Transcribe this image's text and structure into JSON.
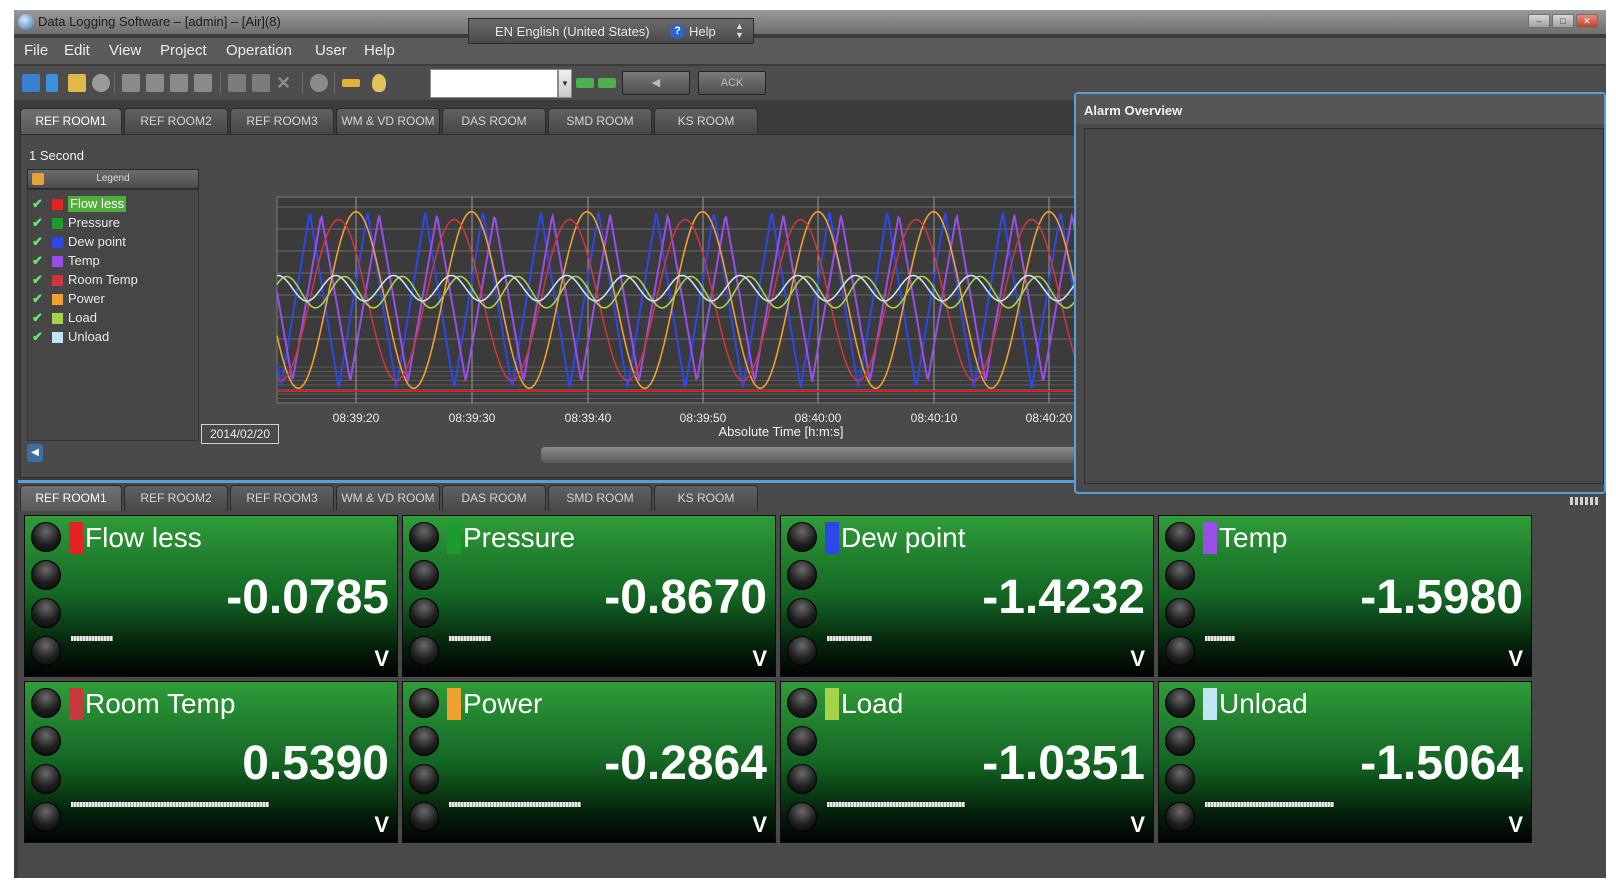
{
  "window": {
    "title": "Data Logging Software – [admin] – [Air](8)",
    "language": "EN English (United States)",
    "help_label": "Help"
  },
  "menu": [
    "File",
    "Edit",
    "View",
    "Project",
    "Operation",
    "User",
    "Help"
  ],
  "toolbar": {
    "combo_value": "",
    "btn_prev_label": "◀",
    "btn_ack_label": "ACK",
    "icons": [
      "grid-icon",
      "import-icon",
      "open-folder-icon",
      "refresh-icon",
      "folder-icon",
      "folder-icon",
      "folder-icon",
      "folder-icon",
      "copy-icon",
      "paste-icon",
      "delete-icon",
      "search-icon",
      "edit-icon",
      "lightbulb-icon",
      "mail-icon",
      "mail-icon"
    ]
  },
  "tabs": [
    "REF ROOM1",
    "REF ROOM2",
    "REF ROOM3",
    "WM & VD ROOM",
    "DAS ROOM",
    "SMD ROOM",
    "KS ROOM"
  ],
  "active_tab": "REF ROOM1",
  "chart_panel": {
    "interval": "1 Second",
    "legend_header": "Legend",
    "date": "2014/02/20",
    "legend": [
      {
        "label": "Flow less",
        "color": "#e52222",
        "checked": true,
        "selected": true
      },
      {
        "label": "Pressure",
        "color": "#1e9a2e",
        "checked": true,
        "selected": false
      },
      {
        "label": "Dew point",
        "color": "#2c48e8",
        "checked": true,
        "selected": false
      },
      {
        "label": "Temp",
        "color": "#9a4ee8",
        "checked": true,
        "selected": false
      },
      {
        "label": "Room Temp",
        "color": "#c8383c",
        "checked": true,
        "selected": false
      },
      {
        "label": "Power",
        "color": "#f0a030",
        "checked": true,
        "selected": false
      },
      {
        "label": "Load",
        "color": "#a6d24a",
        "checked": true,
        "selected": false
      },
      {
        "label": "Unload",
        "color": "#bfe6f2",
        "checked": true,
        "selected": false
      }
    ]
  },
  "chart_data": {
    "type": "line",
    "xlabel": "Absolute Time [h:m:s]",
    "x_ticks": [
      "08:39:20",
      "08:39:30",
      "08:39:40",
      "08:39:50",
      "08:40:00",
      "08:40:10",
      "08:40:20"
    ],
    "grid": true,
    "series": [
      {
        "name": "Flow less",
        "color": "#e52222",
        "kind": "flat",
        "period_s": 0,
        "amplitude": 0,
        "offset": -0.93,
        "phase": 0
      },
      {
        "name": "Dew point",
        "color": "#2c48e8",
        "kind": "sharp",
        "period_s": 5,
        "amplitude": 0.9,
        "offset": 0,
        "phase": 0.6
      },
      {
        "name": "Temp",
        "color": "#9a4ee8",
        "kind": "sharp",
        "period_s": 5,
        "amplitude": 0.85,
        "offset": 0.02,
        "phase": 0.2
      },
      {
        "name": "Power",
        "color": "#f0a030",
        "kind": "sine",
        "period_s": 10,
        "amplitude": 0.9,
        "offset": 0,
        "phase": 0.5
      },
      {
        "name": "Room Temp",
        "color": "#c8383c",
        "kind": "sine",
        "period_s": 10,
        "amplitude": 0.82,
        "offset": 0,
        "phase": 0.8
      },
      {
        "name": "Load",
        "color": "#a6d24a",
        "kind": "sine",
        "period_s": 5,
        "amplitude": 0.16,
        "offset": 0.08,
        "phase": 0.9
      },
      {
        "name": "Unload",
        "color": "#bfe6f2",
        "kind": "sine",
        "period_s": 5,
        "amplitude": 0.13,
        "offset": 0.12,
        "phase": 1.2
      }
    ]
  },
  "alarm": {
    "title": "Alarm Overview"
  },
  "tiles": [
    {
      "name": "Flow less",
      "value": "-0.0785",
      "unit": "V",
      "color": "#e52222",
      "level": 0.14
    },
    {
      "name": "Pressure",
      "value": "-0.8670",
      "unit": "V",
      "color": "#1e9a2e",
      "level": 0.14
    },
    {
      "name": "Dew point",
      "value": "-1.4232",
      "unit": "V",
      "color": "#2c48e8",
      "level": 0.15
    },
    {
      "name": "Temp",
      "value": "-1.5980",
      "unit": "V",
      "color": "#9a4ee8",
      "level": 0.1
    },
    {
      "name": "Room Temp",
      "value": "0.5390",
      "unit": "V",
      "color": "#c8383c",
      "level": 0.66
    },
    {
      "name": "Power",
      "value": "-0.2864",
      "unit": "V",
      "color": "#f0a030",
      "level": 0.44
    },
    {
      "name": "Load",
      "value": "-1.0351",
      "unit": "V",
      "color": "#a6d24a",
      "level": 0.46
    },
    {
      "name": "Unload",
      "value": "-1.5064",
      "unit": "V",
      "color": "#bfe6f2",
      "level": 0.43
    }
  ]
}
